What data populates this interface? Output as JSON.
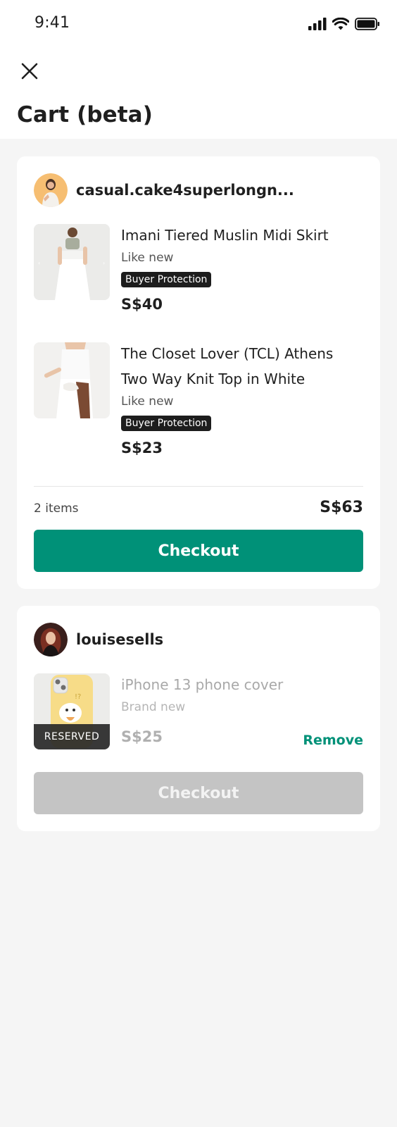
{
  "status_bar": {
    "time": "9:41"
  },
  "header": {
    "title": "Cart (beta)"
  },
  "carts": [
    {
      "seller": "casual.cake4superlongn...",
      "items": [
        {
          "title": "Imani Tiered Muslin Midi Skirt",
          "condition": "Like new",
          "badge": "Buyer Protection",
          "price": "S$40"
        },
        {
          "title": "The Closet Lover (TCL) Athens Two Way Knit Top in White",
          "condition": "Like new",
          "badge": "Buyer Protection",
          "price": "S$23"
        }
      ],
      "summary": {
        "count": "2 items",
        "total": "S$63"
      },
      "checkout_label": "Checkout"
    },
    {
      "seller": "louisesells",
      "items": [
        {
          "title": "iPhone 13 phone cover",
          "condition": "Brand new",
          "reserved_label": "RESERVED",
          "price": "S$25",
          "remove_label": "Remove"
        }
      ],
      "checkout_label": "Checkout"
    }
  ],
  "colors": {
    "accent": "#009178",
    "disabled": "#c4c4c4",
    "background": "#f5f5f5",
    "badge": "#1d1d1d"
  }
}
